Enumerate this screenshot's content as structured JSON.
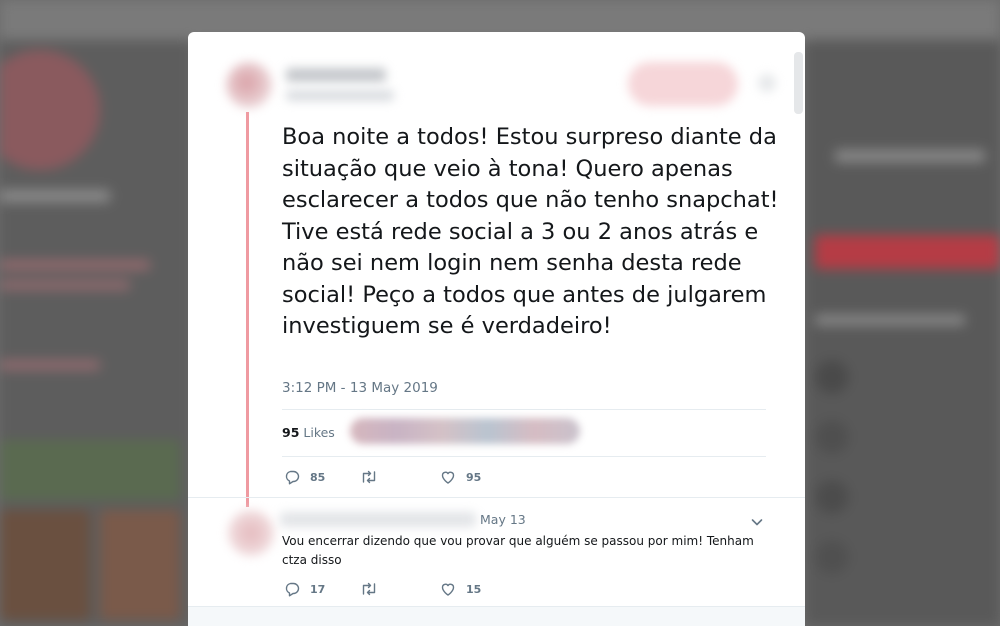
{
  "tweet": {
    "text": "Boa noite a todos! Estou surpreso diante da situação que veio à tona! Quero apenas esclarecer a todos que não tenho snapchat! Tive está rede social a 3 ou 2 anos atrás e não sei nem login nem senha desta rede social! Peço a todos que antes de julgarem investiguem se é verdadeiro!",
    "timestamp": "3:12 PM - 13 May 2019",
    "likes_count": "95",
    "likes_label": "Likes",
    "actions": {
      "reply_count": "85",
      "retweet_count": "",
      "like_count": "95"
    }
  },
  "reply": {
    "date": "May 13",
    "text": "Vou encerrar dizendo que vou provar que alguém se passou por mim! Tenham ctza disso",
    "actions": {
      "reply_count": "17",
      "retweet_count": "",
      "like_count": "15"
    }
  },
  "icons": {
    "reply": "reply-icon",
    "retweet": "retweet-icon",
    "like": "heart-icon",
    "more": "chevron-down-icon"
  },
  "colors": {
    "thread_line": "#ef9aa1",
    "text": "#14171a",
    "secondary_text": "#657786"
  }
}
